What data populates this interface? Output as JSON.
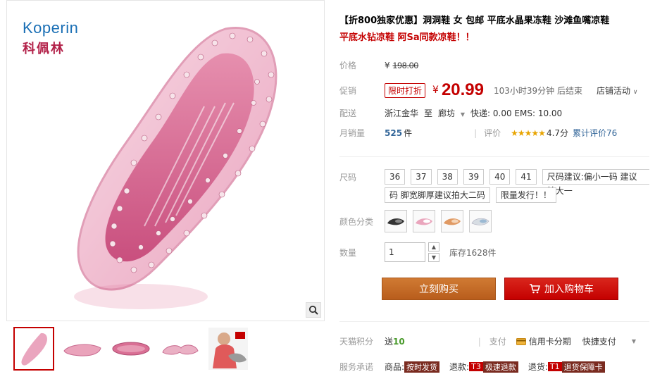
{
  "brand": {
    "name_en": "Koperin",
    "name_cn": "科佩林"
  },
  "product": {
    "title_line1": "【折800独家优惠】洞洞鞋 女 包邮 平底水晶果冻鞋 沙滩鱼嘴凉鞋",
    "title_line2": "平底水钻凉鞋 阿Sa同款凉鞋！！"
  },
  "price": {
    "label": "价格",
    "yen": "¥",
    "original": "198.00"
  },
  "promo": {
    "label": "促销",
    "badge": "限时打折",
    "yen": "¥",
    "price": "20.99",
    "countdown": "103小时39分钟 后结束",
    "shop_activity": "店铺活动"
  },
  "shipping": {
    "label": "配送",
    "from": "浙江金华",
    "to_word": "至",
    "to": "廊坊",
    "fee": "快递: 0.00 EMS: 10.00"
  },
  "sales": {
    "label": "月销量",
    "count": "525",
    "unit": "件",
    "rating_label": "评价",
    "stars": "★★★★★",
    "score": "4.7分",
    "review_count": "累计评价76"
  },
  "sizes": {
    "label": "尺码",
    "options": [
      "36",
      "37",
      "38",
      "39",
      "40",
      "41"
    ],
    "note1_line1": "尺码建议:偏小一码 建议拍大一",
    "note1_line2": "码 脚宽脚厚建议拍大二码",
    "note2": "限量发行！！"
  },
  "colors": {
    "label": "颜色分类",
    "swatches": [
      "black",
      "pink",
      "orange",
      "white"
    ]
  },
  "quantity": {
    "label": "数量",
    "value": "1",
    "stock": "库存1628件"
  },
  "buttons": {
    "buy_now": "立刻购买",
    "add_cart": "加入购物车"
  },
  "points": {
    "label": "天猫积分",
    "send_word": "送",
    "value": "10",
    "pay_label": "支付",
    "credit": "信用卡分期",
    "fast_pay": "快捷支付"
  },
  "service": {
    "label": "服务承诺",
    "goods_label": "商品:",
    "goods_tag": "按时发货",
    "refund_label": "退款:",
    "refund_tag_code": "T3",
    "refund_tag": "极速退款",
    "return_label": "退货:",
    "return_tag_code": "T1",
    "return_tag": "退货保障卡"
  },
  "colors_theme": {
    "accent_red": "#c40000",
    "buy_orange": "#c86e2c",
    "shoe_pink": "#e07aa0"
  }
}
